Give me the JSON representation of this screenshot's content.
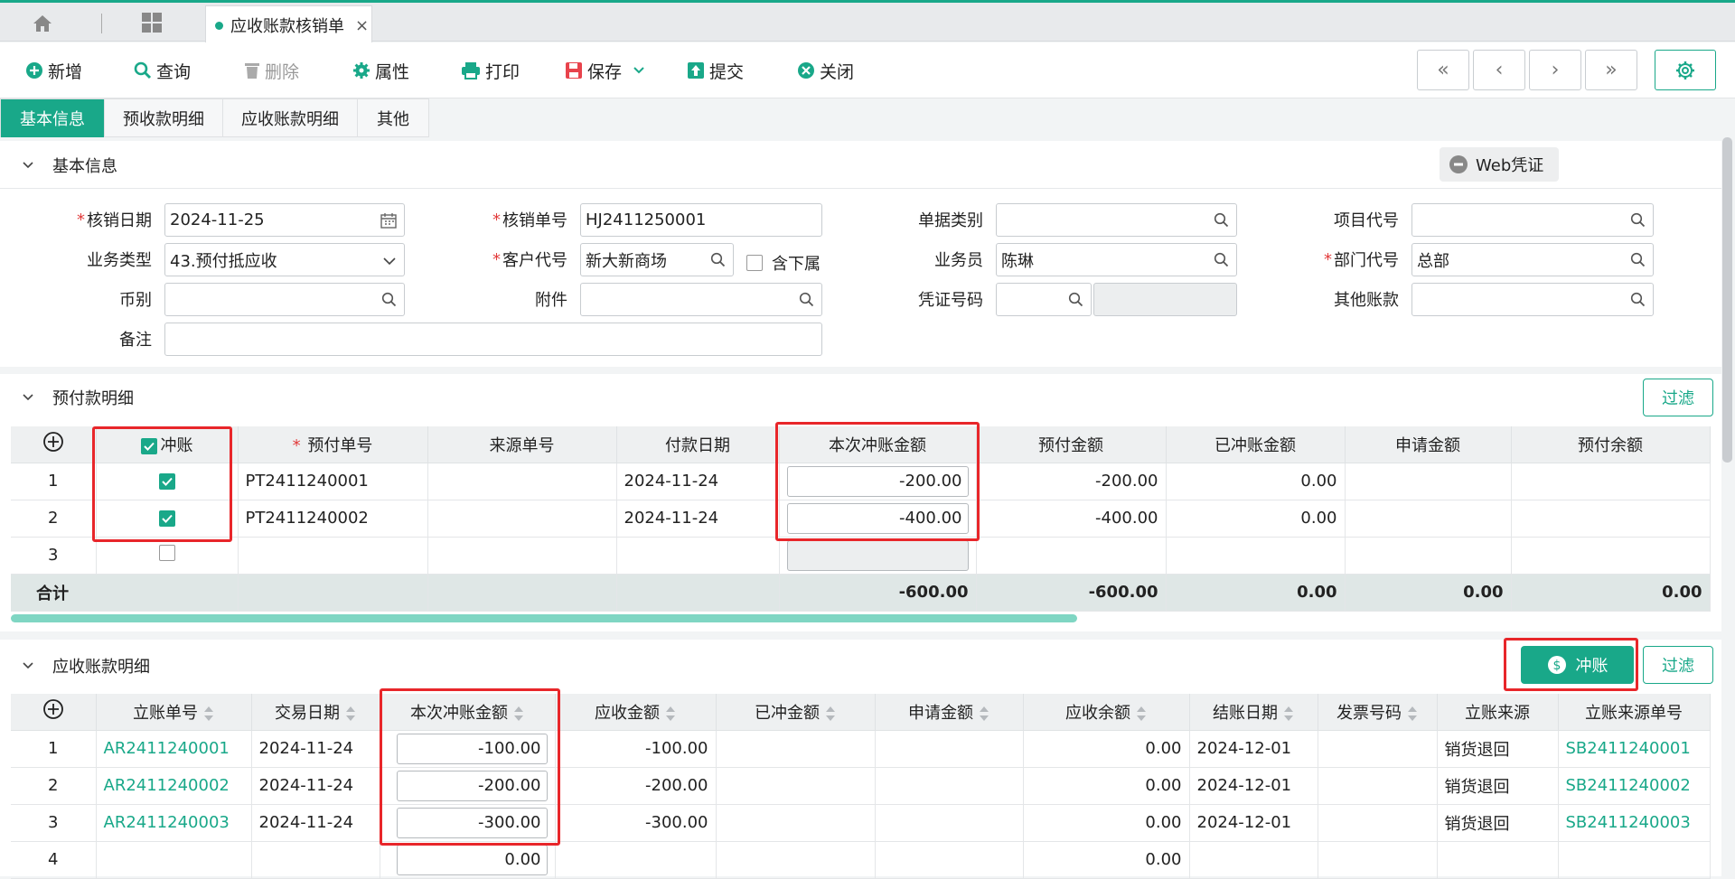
{
  "tabs": {
    "active_label": "应收账款核销单",
    "close": "×"
  },
  "toolbar": {
    "add": "新增",
    "query": "查询",
    "delete": "删除",
    "props": "属性",
    "print": "打印",
    "save": "保存",
    "submit": "提交",
    "close": "关闭",
    "nav": [
      "«",
      "‹",
      "›",
      "»"
    ]
  },
  "subtabs": [
    "基本信息",
    "预收款明细",
    "应收账款明细",
    "其他"
  ],
  "basic": {
    "title": "基本信息",
    "web_voucher": "Web凭证",
    "fields": {
      "date_label": "核销日期",
      "date_value": "2024-11-25",
      "no_label": "核销单号",
      "no_value": "HJ2411250001",
      "doc_type_label": "单据类别",
      "doc_type_value": "",
      "project_label": "项目代号",
      "project_value": "",
      "biz_type_label": "业务类型",
      "biz_type_value": "43.预付抵应收",
      "cust_label": "客户代号",
      "cust_value": "新大新商场",
      "include_sub_label": "含下属",
      "salesman_label": "业务员",
      "salesman_value": "陈琳",
      "dept_label": "部门代号",
      "dept_value": "总部",
      "currency_label": "币别",
      "currency_value": "",
      "attach_label": "附件",
      "attach_value": "",
      "voucher_label": "凭证号码",
      "voucher_value": "",
      "other_label": "其他账款",
      "other_value": "",
      "remark_label": "备注",
      "remark_value": ""
    }
  },
  "prepay": {
    "title": "预付款明细",
    "filter": "过滤",
    "headers": [
      "冲账",
      "预付单号",
      "来源单号",
      "付款日期",
      "本次冲账金额",
      "预付金额",
      "已冲账金额",
      "申请金额",
      "预付余额"
    ],
    "rows": [
      {
        "idx": "1",
        "checked": true,
        "no": "PT2411240001",
        "src": "",
        "date": "2024-11-24",
        "amount": "-200.00",
        "prepay": "-200.00",
        "offset": "0.00",
        "apply": "",
        "balance": ""
      },
      {
        "idx": "2",
        "checked": true,
        "no": "PT2411240002",
        "src": "",
        "date": "2024-11-24",
        "amount": "-400.00",
        "prepay": "-400.00",
        "offset": "0.00",
        "apply": "",
        "balance": ""
      },
      {
        "idx": "3",
        "checked": false,
        "no": "",
        "src": "",
        "date": "",
        "amount": "",
        "prepay": "",
        "offset": "",
        "apply": "",
        "balance": ""
      }
    ],
    "sum": {
      "label": "合计",
      "amount": "-600.00",
      "prepay": "-600.00",
      "offset": "0.00",
      "apply": "0.00",
      "balance": "0.00"
    }
  },
  "ar": {
    "title": "应收账款明细",
    "offset_btn": "冲账",
    "filter": "过滤",
    "headers": [
      "立账单号",
      "交易日期",
      "本次冲账金额",
      "应收金额",
      "已冲金额",
      "申请金额",
      "应收余额",
      "结账日期",
      "发票号码",
      "立账来源",
      "立账来源单号"
    ],
    "rows": [
      {
        "idx": "1",
        "no": "AR2411240001",
        "date": "2024-11-24",
        "amount": "-100.00",
        "recv": "-100.00",
        "done": "",
        "apply": "",
        "balance": "0.00",
        "close": "2024-12-01",
        "invoice": "",
        "src": "销货退回",
        "src_no": "SB2411240001"
      },
      {
        "idx": "2",
        "no": "AR2411240002",
        "date": "2024-11-24",
        "amount": "-200.00",
        "recv": "-200.00",
        "done": "",
        "apply": "",
        "balance": "0.00",
        "close": "2024-12-01",
        "invoice": "",
        "src": "销货退回",
        "src_no": "SB2411240002"
      },
      {
        "idx": "3",
        "no": "AR2411240003",
        "date": "2024-11-24",
        "amount": "-300.00",
        "recv": "-300.00",
        "done": "",
        "apply": "",
        "balance": "0.00",
        "close": "2024-12-01",
        "invoice": "",
        "src": "销货退回",
        "src_no": "SB2411240003"
      },
      {
        "idx": "4",
        "no": "",
        "date": "",
        "amount": "0.00",
        "recv": "",
        "done": "",
        "apply": "",
        "balance": "0.00",
        "close": "",
        "invoice": "",
        "src": "",
        "src_no": ""
      }
    ]
  },
  "colors": {
    "accent": "#19a889",
    "highlight": "#e8262a"
  }
}
